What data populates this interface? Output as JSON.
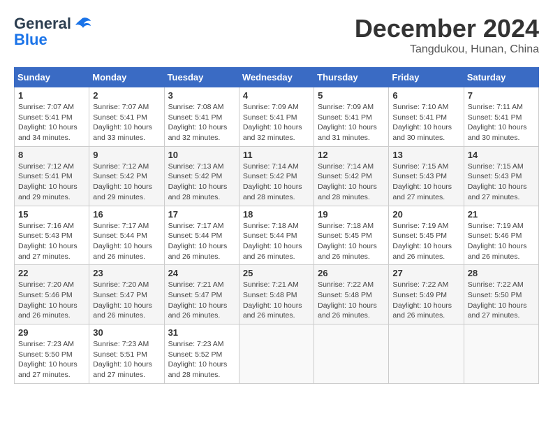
{
  "logo": {
    "general": "General",
    "blue": "Blue"
  },
  "title": "December 2024",
  "location": "Tangdukou, Hunan, China",
  "days_header": [
    "Sunday",
    "Monday",
    "Tuesday",
    "Wednesday",
    "Thursday",
    "Friday",
    "Saturday"
  ],
  "weeks": [
    [
      {
        "day": "1",
        "sunrise": "Sunrise: 7:07 AM",
        "sunset": "Sunset: 5:41 PM",
        "daylight": "Daylight: 10 hours and 34 minutes."
      },
      {
        "day": "2",
        "sunrise": "Sunrise: 7:07 AM",
        "sunset": "Sunset: 5:41 PM",
        "daylight": "Daylight: 10 hours and 33 minutes."
      },
      {
        "day": "3",
        "sunrise": "Sunrise: 7:08 AM",
        "sunset": "Sunset: 5:41 PM",
        "daylight": "Daylight: 10 hours and 32 minutes."
      },
      {
        "day": "4",
        "sunrise": "Sunrise: 7:09 AM",
        "sunset": "Sunset: 5:41 PM",
        "daylight": "Daylight: 10 hours and 32 minutes."
      },
      {
        "day": "5",
        "sunrise": "Sunrise: 7:09 AM",
        "sunset": "Sunset: 5:41 PM",
        "daylight": "Daylight: 10 hours and 31 minutes."
      },
      {
        "day": "6",
        "sunrise": "Sunrise: 7:10 AM",
        "sunset": "Sunset: 5:41 PM",
        "daylight": "Daylight: 10 hours and 30 minutes."
      },
      {
        "day": "7",
        "sunrise": "Sunrise: 7:11 AM",
        "sunset": "Sunset: 5:41 PM",
        "daylight": "Daylight: 10 hours and 30 minutes."
      }
    ],
    [
      {
        "day": "8",
        "sunrise": "Sunrise: 7:12 AM",
        "sunset": "Sunset: 5:41 PM",
        "daylight": "Daylight: 10 hours and 29 minutes."
      },
      {
        "day": "9",
        "sunrise": "Sunrise: 7:12 AM",
        "sunset": "Sunset: 5:42 PM",
        "daylight": "Daylight: 10 hours and 29 minutes."
      },
      {
        "day": "10",
        "sunrise": "Sunrise: 7:13 AM",
        "sunset": "Sunset: 5:42 PM",
        "daylight": "Daylight: 10 hours and 28 minutes."
      },
      {
        "day": "11",
        "sunrise": "Sunrise: 7:14 AM",
        "sunset": "Sunset: 5:42 PM",
        "daylight": "Daylight: 10 hours and 28 minutes."
      },
      {
        "day": "12",
        "sunrise": "Sunrise: 7:14 AM",
        "sunset": "Sunset: 5:42 PM",
        "daylight": "Daylight: 10 hours and 28 minutes."
      },
      {
        "day": "13",
        "sunrise": "Sunrise: 7:15 AM",
        "sunset": "Sunset: 5:43 PM",
        "daylight": "Daylight: 10 hours and 27 minutes."
      },
      {
        "day": "14",
        "sunrise": "Sunrise: 7:15 AM",
        "sunset": "Sunset: 5:43 PM",
        "daylight": "Daylight: 10 hours and 27 minutes."
      }
    ],
    [
      {
        "day": "15",
        "sunrise": "Sunrise: 7:16 AM",
        "sunset": "Sunset: 5:43 PM",
        "daylight": "Daylight: 10 hours and 27 minutes."
      },
      {
        "day": "16",
        "sunrise": "Sunrise: 7:17 AM",
        "sunset": "Sunset: 5:44 PM",
        "daylight": "Daylight: 10 hours and 26 minutes."
      },
      {
        "day": "17",
        "sunrise": "Sunrise: 7:17 AM",
        "sunset": "Sunset: 5:44 PM",
        "daylight": "Daylight: 10 hours and 26 minutes."
      },
      {
        "day": "18",
        "sunrise": "Sunrise: 7:18 AM",
        "sunset": "Sunset: 5:44 PM",
        "daylight": "Daylight: 10 hours and 26 minutes."
      },
      {
        "day": "19",
        "sunrise": "Sunrise: 7:18 AM",
        "sunset": "Sunset: 5:45 PM",
        "daylight": "Daylight: 10 hours and 26 minutes."
      },
      {
        "day": "20",
        "sunrise": "Sunrise: 7:19 AM",
        "sunset": "Sunset: 5:45 PM",
        "daylight": "Daylight: 10 hours and 26 minutes."
      },
      {
        "day": "21",
        "sunrise": "Sunrise: 7:19 AM",
        "sunset": "Sunset: 5:46 PM",
        "daylight": "Daylight: 10 hours and 26 minutes."
      }
    ],
    [
      {
        "day": "22",
        "sunrise": "Sunrise: 7:20 AM",
        "sunset": "Sunset: 5:46 PM",
        "daylight": "Daylight: 10 hours and 26 minutes."
      },
      {
        "day": "23",
        "sunrise": "Sunrise: 7:20 AM",
        "sunset": "Sunset: 5:47 PM",
        "daylight": "Daylight: 10 hours and 26 minutes."
      },
      {
        "day": "24",
        "sunrise": "Sunrise: 7:21 AM",
        "sunset": "Sunset: 5:47 PM",
        "daylight": "Daylight: 10 hours and 26 minutes."
      },
      {
        "day": "25",
        "sunrise": "Sunrise: 7:21 AM",
        "sunset": "Sunset: 5:48 PM",
        "daylight": "Daylight: 10 hours and 26 minutes."
      },
      {
        "day": "26",
        "sunrise": "Sunrise: 7:22 AM",
        "sunset": "Sunset: 5:48 PM",
        "daylight": "Daylight: 10 hours and 26 minutes."
      },
      {
        "day": "27",
        "sunrise": "Sunrise: 7:22 AM",
        "sunset": "Sunset: 5:49 PM",
        "daylight": "Daylight: 10 hours and 26 minutes."
      },
      {
        "day": "28",
        "sunrise": "Sunrise: 7:22 AM",
        "sunset": "Sunset: 5:50 PM",
        "daylight": "Daylight: 10 hours and 27 minutes."
      }
    ],
    [
      {
        "day": "29",
        "sunrise": "Sunrise: 7:23 AM",
        "sunset": "Sunset: 5:50 PM",
        "daylight": "Daylight: 10 hours and 27 minutes."
      },
      {
        "day": "30",
        "sunrise": "Sunrise: 7:23 AM",
        "sunset": "Sunset: 5:51 PM",
        "daylight": "Daylight: 10 hours and 27 minutes."
      },
      {
        "day": "31",
        "sunrise": "Sunrise: 7:23 AM",
        "sunset": "Sunset: 5:52 PM",
        "daylight": "Daylight: 10 hours and 28 minutes."
      },
      null,
      null,
      null,
      null
    ]
  ]
}
